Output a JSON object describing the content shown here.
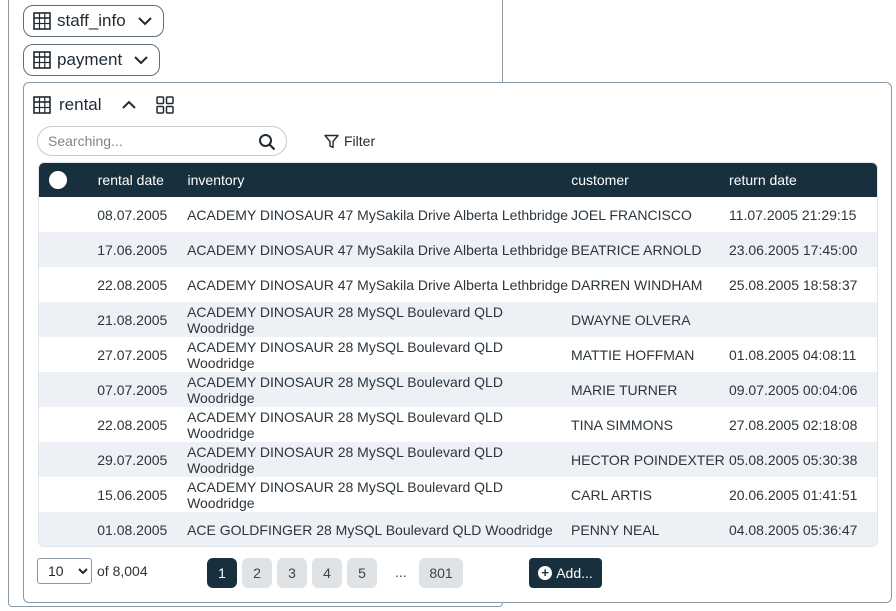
{
  "tables": [
    {
      "name": "staff_info"
    },
    {
      "name": "payment"
    }
  ],
  "panel": {
    "title": "rental"
  },
  "search": {
    "placeholder": "Searching..."
  },
  "filter": {
    "label": "Filter"
  },
  "columns": [
    "rental date",
    "inventory",
    "customer",
    "return date"
  ],
  "rows": [
    {
      "rental_date": "08.07.2005",
      "inventory": "ACADEMY DINOSAUR 47 MySakila Drive Alberta Lethbridge",
      "customer": "JOEL FRANCISCO",
      "return_date": "11.07.2005 21:29:15"
    },
    {
      "rental_date": "17.06.2005",
      "inventory": "ACADEMY DINOSAUR 47 MySakila Drive Alberta Lethbridge",
      "customer": "BEATRICE ARNOLD",
      "return_date": "23.06.2005 17:45:00"
    },
    {
      "rental_date": "22.08.2005",
      "inventory": "ACADEMY DINOSAUR 47 MySakila Drive Alberta Lethbridge",
      "customer": "DARREN WINDHAM",
      "return_date": "25.08.2005 18:58:37"
    },
    {
      "rental_date": "21.08.2005",
      "inventory": "ACADEMY DINOSAUR 28 MySQL Boulevard QLD Woodridge",
      "customer": "DWAYNE OLVERA",
      "return_date": ""
    },
    {
      "rental_date": "27.07.2005",
      "inventory": "ACADEMY DINOSAUR 28 MySQL Boulevard QLD Woodridge",
      "customer": "MATTIE HOFFMAN",
      "return_date": "01.08.2005 04:08:11"
    },
    {
      "rental_date": "07.07.2005",
      "inventory": "ACADEMY DINOSAUR 28 MySQL Boulevard QLD Woodridge",
      "customer": "MARIE TURNER",
      "return_date": "09.07.2005 00:04:06"
    },
    {
      "rental_date": "22.08.2005",
      "inventory": "ACADEMY DINOSAUR 28 MySQL Boulevard QLD Woodridge",
      "customer": "TINA SIMMONS",
      "return_date": "27.08.2005 02:18:08"
    },
    {
      "rental_date": "29.07.2005",
      "inventory": "ACADEMY DINOSAUR 28 MySQL Boulevard QLD Woodridge",
      "customer": "HECTOR POINDEXTER",
      "return_date": "05.08.2005 05:30:38"
    },
    {
      "rental_date": "15.06.2005",
      "inventory": "ACADEMY DINOSAUR 28 MySQL Boulevard QLD Woodridge",
      "customer": "CARL ARTIS",
      "return_date": "20.06.2005 01:41:51"
    },
    {
      "rental_date": "01.08.2005",
      "inventory": "ACE GOLDFINGER 28 MySQL Boulevard QLD Woodridge",
      "customer": "PENNY NEAL",
      "return_date": "04.08.2005 05:36:47"
    }
  ],
  "pagination": {
    "page_size": "10",
    "total": "of 8,004",
    "pages": [
      "1",
      "2",
      "3",
      "4",
      "5"
    ],
    "ellipsis": "...",
    "last": "801",
    "current": "1"
  },
  "add_button": {
    "label": "Add..."
  },
  "colors": {
    "header": "#18303d",
    "alt_row": "#edf1f6",
    "page_btn": "#dfe3e6"
  }
}
